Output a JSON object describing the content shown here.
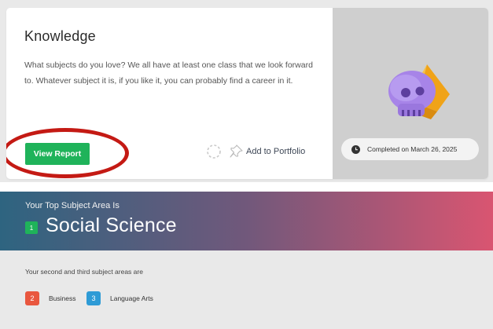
{
  "card": {
    "title": "Knowledge",
    "description": "What subjects do you love? We all have at least one class that we look forward to. Whatever subject it is, if you like it, you can probably find a career in it.",
    "view_report_label": "View Report",
    "add_portfolio_label": "Add to Portfolio",
    "completed_label": "Completed on March 26, 2025",
    "icons": [
      "loading-spinner-icon",
      "pin-icon",
      "clock-icon",
      "skull-shapes-illustration"
    ]
  },
  "banner": {
    "subtitle": "Your Top Subject Area Is",
    "rank": "1",
    "top_subject": "Social Science"
  },
  "secondary": {
    "intro": "Your second and third subject areas are",
    "areas": [
      {
        "rank": "2",
        "name": "Business",
        "color": "#e9573f"
      },
      {
        "rank": "3",
        "name": "Language Arts",
        "color": "#2e9bd6"
      }
    ]
  },
  "colors": {
    "accent_green": "#1fb35a",
    "highlight_red": "#c41a14",
    "banner_start": "#2e6480",
    "banner_end": "#d95571"
  }
}
